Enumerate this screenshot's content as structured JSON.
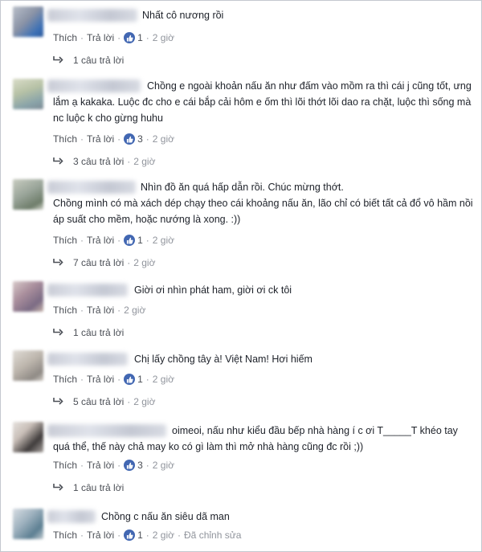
{
  "ui": {
    "like_label": "Thích",
    "reply_label": "Trả lời",
    "separator": "·",
    "colors": {
      "text": "#1d2129",
      "meta": "#90949c",
      "link": "#4b4f56",
      "like_badge": "#4267b2"
    }
  },
  "comments": [
    {
      "text_lines": [
        "Nhất cô nương rồi"
      ],
      "likes": "1",
      "time": "2 giờ",
      "replies": "1 câu trả lời",
      "replies_time": ""
    },
    {
      "text_lines": [
        "Chồng e ngoài khoản nấu ăn như đấm vào mồm ra thì cái j cũng tốt, ưng",
        "lắm ạ kakaka. Luộc đc cho e cái bắp cải hôm e ốm thì lõi thớt lõi dao ra chặt, luộc thì sống mà",
        "nc luộc k cho gừng huhu"
      ],
      "likes": "3",
      "time": "2 giờ",
      "replies": "3 câu trả lời",
      "replies_time": "2 giờ"
    },
    {
      "text_lines": [
        "Nhìn đồ ăn quá hấp dẫn rồi. Chúc mừng thớt.",
        "Chồng mình có mà xách dép chạy theo cái khoảng nấu ăn, lão chỉ có biết tất cả đổ vô hầm nồi",
        "áp suất cho mềm, hoặc nướng là xong. :))"
      ],
      "likes": "1",
      "time": "2 giờ",
      "replies": "7 câu trả lời",
      "replies_time": "2 giờ"
    },
    {
      "text_lines": [
        "Giời ơi nhìn phát ham, giời ơi ck tôi"
      ],
      "likes": "",
      "time": "2 giờ",
      "replies": "1 câu trả lời",
      "replies_time": ""
    },
    {
      "text_lines": [
        "Chị lấy chồng tây à! Việt Nam! Hơi hiếm"
      ],
      "likes": "1",
      "time": "2 giờ",
      "replies": "5 câu trả lời",
      "replies_time": "2 giờ"
    },
    {
      "text_lines": [
        "oimeoi, nấu như kiểu đầu bếp nhà hàng í c ơi T_____T khéo tay",
        "quá thể, thế này chả may ko có gì làm thì mở nhà hàng cũng đc rồi ;))"
      ],
      "likes": "3",
      "time": "2 giờ",
      "replies": "1 câu trả lời",
      "replies_time": ""
    },
    {
      "text_lines": [
        "Chồng c nấu ăn siêu dã man"
      ],
      "likes": "1",
      "time": "2 giờ",
      "edited": "Đã chỉnh sửa",
      "replies": "",
      "replies_time": ""
    }
  ]
}
